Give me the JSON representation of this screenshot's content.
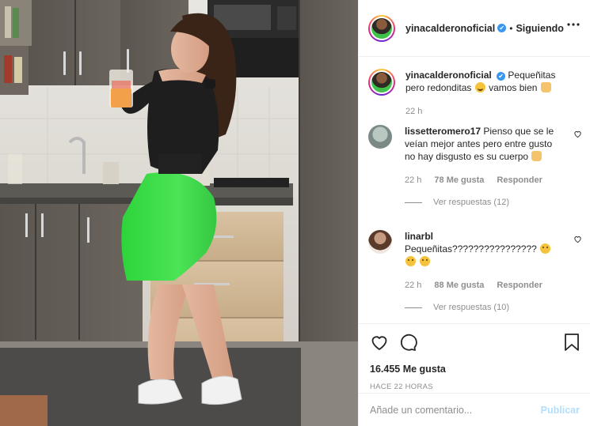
{
  "post": {
    "author": "yinacalderonoficial",
    "follow_status": "Siguiendo",
    "separator": "•",
    "verified_mark": "✔"
  },
  "caption": {
    "username": "yinacalderonoficial",
    "text": "Pequeñitas pero redonditas",
    "text_after": "vamos bien",
    "time": "22 h"
  },
  "comments": [
    {
      "username": "lissetteromero17",
      "text": "Pienso que se le veían mejor antes pero entre gusto no hay disgusto es su cuerpo",
      "time": "22 h",
      "likes": "78 Me gusta",
      "reply_label": "Responder",
      "view_replies": "Ver respuestas (12)"
    },
    {
      "username": "linarbl",
      "text": "Pequeñitas????????????????",
      "time": "22 h",
      "likes": "88 Me gusta",
      "reply_label": "Responder",
      "view_replies": "Ver respuestas (10)"
    }
  ],
  "stats": {
    "likes": "16.455 Me gusta",
    "timestamp": "HACE 22 HORAS"
  },
  "composer": {
    "placeholder": "Añade un comentario...",
    "publish_label": "Publicar"
  },
  "icons": {
    "like": "heart-icon",
    "comment": "comment-icon",
    "save": "bookmark-icon",
    "more": "more-options-icon"
  },
  "colors": {
    "verified": "#3897f0",
    "muted": "#8e8e8e",
    "publish_disabled": "#b2dffc",
    "border": "#efefef"
  }
}
